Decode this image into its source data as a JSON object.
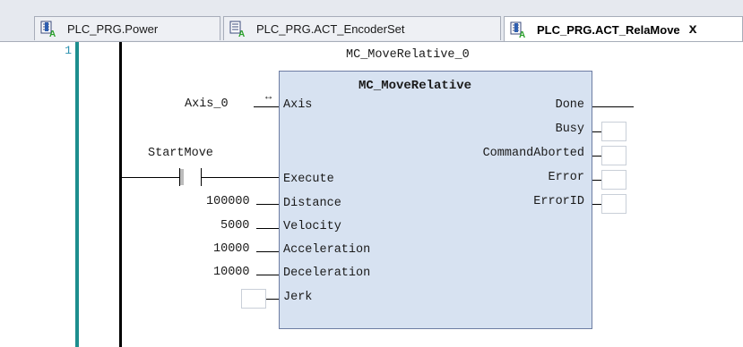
{
  "tabs": [
    {
      "label": "PLC_PRG.Power",
      "icon": "program-icon",
      "active": false
    },
    {
      "label": "PLC_PRG.ACT_EncoderSet",
      "icon": "action-icon",
      "active": false
    },
    {
      "label": "PLC_PRG.ACT_RelaMove",
      "icon": "program-icon",
      "active": true,
      "close": "x"
    }
  ],
  "editor": {
    "line_number": "1",
    "instance_name": "MC_MoveRelative_0",
    "fb_type": "MC_MoveRelative",
    "inputs": [
      {
        "name": "Axis",
        "value": "Axis_0",
        "ref_glyph": "↔"
      },
      {
        "name": "Execute",
        "contact": "StartMove"
      },
      {
        "name": "Distance",
        "value": "100000"
      },
      {
        "name": "Velocity",
        "value": "5000"
      },
      {
        "name": "Acceleration",
        "value": "10000"
      },
      {
        "name": "Deceleration",
        "value": "10000"
      },
      {
        "name": "Jerk",
        "value": ""
      }
    ],
    "outputs": [
      {
        "name": "Done"
      },
      {
        "name": "Busy"
      },
      {
        "name": "CommandAborted"
      },
      {
        "name": "Error"
      },
      {
        "name": "ErrorID"
      }
    ]
  }
}
